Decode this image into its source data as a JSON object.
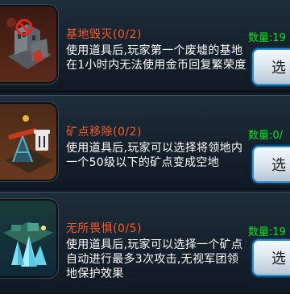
{
  "items": [
    {
      "icon": "destroyed-building-icon",
      "name": "基地毁灭",
      "count": "(0/2)",
      "description": "使用道具后,玩家第一个废墟的基地在1小时内无法使用金币回复繁荣度",
      "quantity": "数量:19",
      "button": "选"
    },
    {
      "icon": "mine-removal-icon",
      "name": "矿点移除",
      "count": "(0/2)",
      "description": "使用道具后,玩家可以选择将领地内一个50级以下的矿点变成空地",
      "quantity": "数量:0/",
      "button": "选"
    },
    {
      "icon": "crystal-mine-icon",
      "name": "无所畏惧",
      "count": "(0/5)",
      "description": "使用道具后,玩家可以选择一个矿点自动进行最多3次攻击,无视军团领地保护效果",
      "quantity": "数量:19",
      "button": "选"
    }
  ]
}
